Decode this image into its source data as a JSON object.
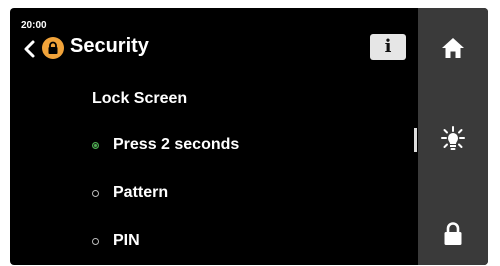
{
  "status": {
    "time": "20:00"
  },
  "header": {
    "title": "Security",
    "back_icon": "chevron-left-icon",
    "badge_icon": "lock-icon",
    "badge_color": "#f1a33a",
    "info_label": "i"
  },
  "lock_screen": {
    "label": "Lock Screen",
    "options": [
      {
        "label": "Press 2 seconds",
        "selected": true
      },
      {
        "label": "Pattern",
        "selected": false
      },
      {
        "label": "PIN",
        "selected": false
      }
    ]
  },
  "sidebar": {
    "items": [
      {
        "icon": "home-icon"
      },
      {
        "icon": "light-bulb-icon"
      },
      {
        "icon": "lock-icon"
      }
    ]
  },
  "colors": {
    "selected": "#4caf50",
    "sidebar_bg": "#3a3a3a"
  }
}
